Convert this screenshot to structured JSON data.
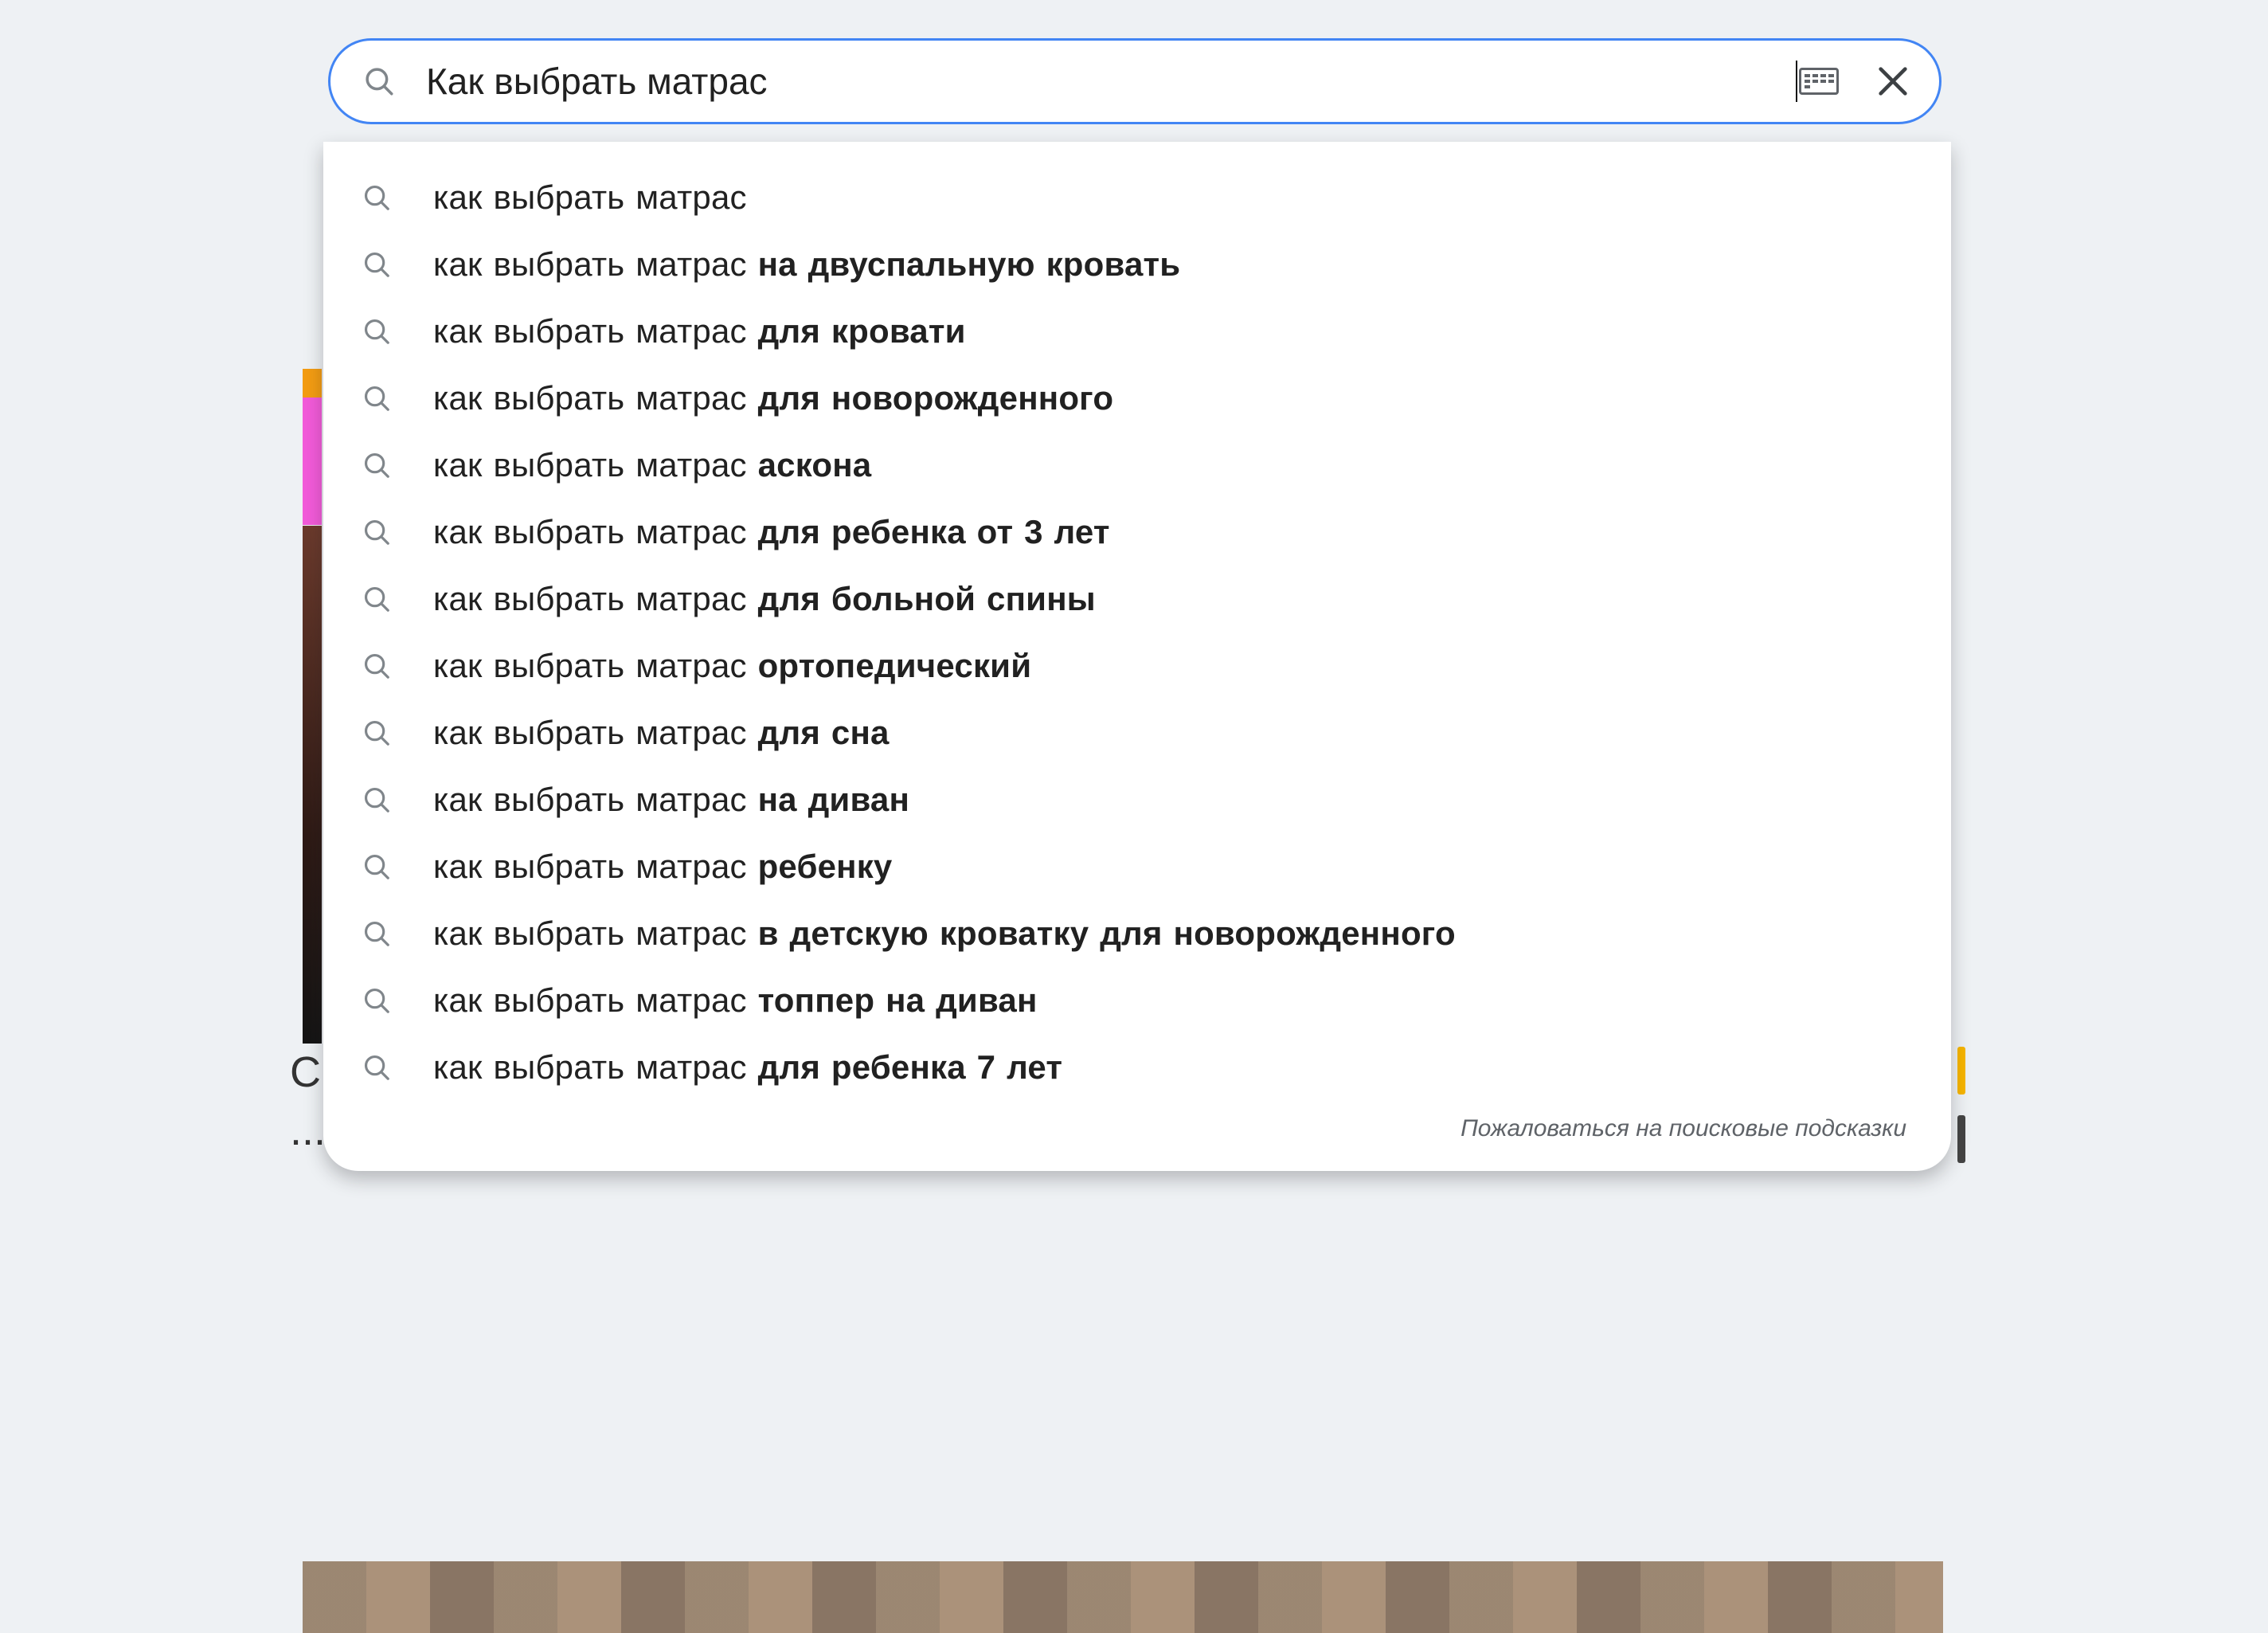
{
  "search": {
    "value": "Как выбрать матрас",
    "keyboard_icon": "keyboard-icon",
    "clear_icon": "close-icon",
    "search_icon": "search-icon"
  },
  "suggestions": [
    {
      "prefix": "как выбрать матрас",
      "suffix": ""
    },
    {
      "prefix": "как выбрать матрас ",
      "suffix": "на двуспальную кровать"
    },
    {
      "prefix": "как выбрать матрас ",
      "suffix": "для кровати"
    },
    {
      "prefix": "как выбрать матрас ",
      "suffix": "для новорожденного"
    },
    {
      "prefix": "как выбрать матрас ",
      "suffix": "аскона"
    },
    {
      "prefix": "как выбрать матрас ",
      "suffix": "для ребенка от 3 лет"
    },
    {
      "prefix": "как выбрать матрас ",
      "suffix": "для больной спины"
    },
    {
      "prefix": "как выбрать матрас ",
      "suffix": "ортопедический"
    },
    {
      "prefix": "как выбрать матрас ",
      "suffix": "для сна"
    },
    {
      "prefix": "как выбрать матрас ",
      "suffix": "на диван"
    },
    {
      "prefix": "как выбрать матрас ",
      "suffix": "ребенку"
    },
    {
      "prefix": "как выбрать матрас ",
      "suffix": "в детскую кроватку для новорожденного"
    },
    {
      "prefix": "как выбрать матрас ",
      "suffix": "топпер на диван"
    },
    {
      "prefix": "как выбрать матрас ",
      "suffix": "для ребенка 7 лет"
    }
  ],
  "report_link": "Пожаловаться на поисковые подсказки",
  "background_hints": {
    "left_letter": "С",
    "left_dots": "..."
  }
}
